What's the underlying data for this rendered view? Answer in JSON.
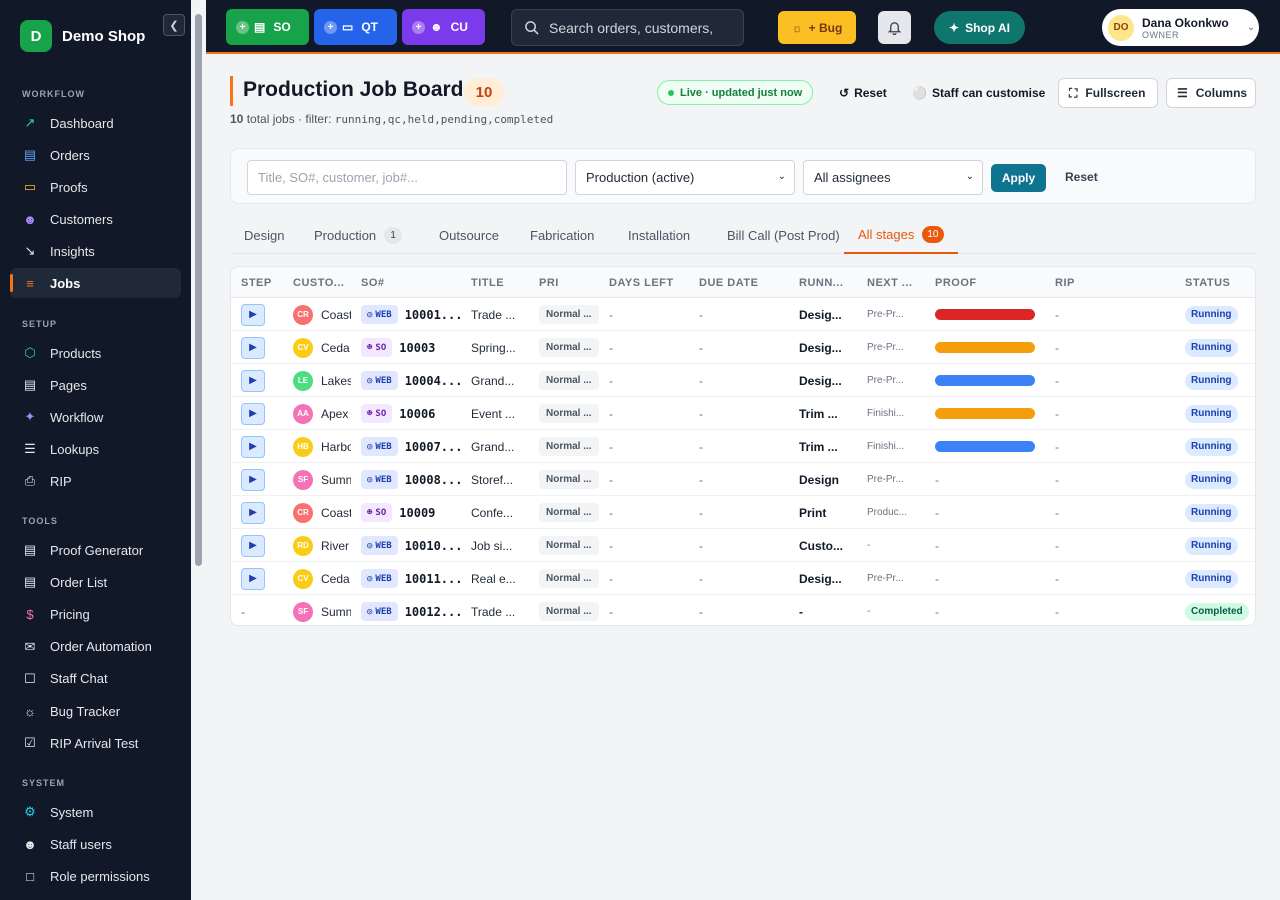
{
  "sidebar": {
    "brand": "Demo Shop",
    "logo_letter": "D",
    "collapse_icon": "chevron-left-icon",
    "sections": [
      {
        "label": "WORKFLOW",
        "items": [
          {
            "label": "Dashboard",
            "icon": "trend-icon",
            "color": "#34d399"
          },
          {
            "label": "Orders",
            "icon": "clipboard-icon",
            "color": "#60a5fa"
          },
          {
            "label": "Proofs",
            "icon": "file-icon",
            "color": "#fbbf24"
          },
          {
            "label": "Customers",
            "icon": "user-icon",
            "color": "#a78bfa"
          },
          {
            "label": "Insights",
            "icon": "chart-icon",
            "color": "#e5e7eb"
          },
          {
            "label": "Jobs",
            "icon": "list-icon",
            "color": "#f97316",
            "active": true
          }
        ]
      },
      {
        "label": "SETUP",
        "items": [
          {
            "label": "Products",
            "icon": "box-icon",
            "color": "#34d399"
          },
          {
            "label": "Pages",
            "icon": "page-icon",
            "color": "#e5e7eb"
          },
          {
            "label": "Workflow",
            "icon": "workflow-icon",
            "color": "#a78bfa"
          },
          {
            "label": "Lookups",
            "icon": "lookup-icon",
            "color": "#e5e7eb"
          },
          {
            "label": "RIP",
            "icon": "printer-icon",
            "color": "#e5e7eb"
          }
        ]
      },
      {
        "label": "TOOLS",
        "items": [
          {
            "label": "Proof Generator",
            "icon": "doc-icon",
            "color": "#e5e7eb"
          },
          {
            "label": "Order List",
            "icon": "clipboard-icon",
            "color": "#e5e7eb"
          },
          {
            "label": "Pricing",
            "icon": "dollar-icon",
            "color": "#f472b6"
          },
          {
            "label": "Order Automation",
            "icon": "mail-icon",
            "color": "#e5e7eb"
          },
          {
            "label": "Staff Chat",
            "icon": "chat-icon",
            "color": "#e5e7eb"
          },
          {
            "label": "Bug Tracker",
            "icon": "bug-icon",
            "color": "#e5e7eb"
          },
          {
            "label": "RIP Arrival Test",
            "icon": "check-icon",
            "color": "#e5e7eb"
          }
        ]
      },
      {
        "label": "SYSTEM",
        "items": [
          {
            "label": "System",
            "icon": "gear-icon",
            "color": "#22d3ee"
          },
          {
            "label": "Staff users",
            "icon": "users-icon",
            "color": "#e5e7eb"
          },
          {
            "label": "Role permissions",
            "icon": "lock-icon",
            "color": "#e5e7eb"
          }
        ]
      }
    ]
  },
  "topbar": {
    "quick": [
      {
        "label": "SO",
        "color": "#16a34a",
        "icon": "doc-icon"
      },
      {
        "label": "QT",
        "color": "#2563eb",
        "icon": "file-icon"
      },
      {
        "label": "CU",
        "color": "#7c3aed",
        "icon": "user-icon"
      }
    ],
    "search_placeholder": "Search orders, customers,",
    "bug_label": "+ Bug",
    "ai_label": "Shop AI",
    "user_initials": "DO",
    "user_name": "Dana Okonkwo",
    "user_role": "OWNER"
  },
  "header": {
    "title": "Production Job Board",
    "count": "10",
    "total_count": "10",
    "total_text": "total jobs · filter:",
    "filter_value": "running,qc,held,pending,completed",
    "live_label": "Live · updated just now",
    "reset_label": "Reset",
    "staff_label": "Staff can customise",
    "fullscreen_label": "Fullscreen",
    "columns_label": "Columns"
  },
  "filters": {
    "search_placeholder": "Title, SO#, customer, job#...",
    "stage_value": "Production (active)",
    "assignee_value": "All assignees",
    "apply_label": "Apply",
    "reset_label": "Reset"
  },
  "tabs": [
    {
      "label": "Design",
      "count": ""
    },
    {
      "label": "Production",
      "count": "1"
    },
    {
      "label": "Outsource",
      "count": ""
    },
    {
      "label": "Fabrication",
      "count": ""
    },
    {
      "label": "Installation",
      "count": ""
    },
    {
      "label": "Bill Call (Post Prod)",
      "count": ""
    },
    {
      "label": "All stages",
      "count": "10",
      "active": true
    }
  ],
  "table": {
    "columns": [
      "STEP",
      "CUSTO...",
      "SO#",
      "TITLE",
      "PRI",
      "DAYS LEFT",
      "DUE DATE",
      "RUNN...",
      "NEXT ...",
      "PROOF",
      "RIP",
      "STATUS"
    ],
    "rows": [
      {
        "step": "play",
        "initials": "CR",
        "avatar_color": "#f87171",
        "customer": "Coast",
        "source": "WEB",
        "so": "10001...",
        "title": "Trade ...",
        "pri": "Normal ...",
        "days": "-",
        "due": "-",
        "running": "Desig...",
        "next": "Pre-Pr...",
        "proof_color": "#dc2626",
        "rip": "-",
        "status": "Running"
      },
      {
        "step": "play",
        "initials": "CV",
        "avatar_color": "#facc15",
        "customer": "Ceda",
        "source": "SO",
        "so": "10003",
        "title": "Spring...",
        "pri": "Normal ...",
        "days": "-",
        "due": "-",
        "running": "Desig...",
        "next": "Pre-Pr...",
        "proof_color": "#f59e0b",
        "rip": "-",
        "status": "Running"
      },
      {
        "step": "play",
        "initials": "LE",
        "avatar_color": "#4ade80",
        "customer": "Lakes",
        "source": "WEB",
        "so": "10004...",
        "title": "Grand...",
        "pri": "Normal ...",
        "days": "-",
        "due": "-",
        "running": "Desig...",
        "next": "Pre-Pr...",
        "proof_color": "#3b82f6",
        "rip": "-",
        "status": "Running"
      },
      {
        "step": "play",
        "initials": "AA",
        "avatar_color": "#f472b6",
        "customer": "Apex",
        "source": "SO",
        "so": "10006",
        "title": "Event ...",
        "pri": "Normal ...",
        "days": "-",
        "due": "-",
        "running": "Trim ...",
        "next": "Finishi...",
        "proof_color": "#f59e0b",
        "rip": "-",
        "status": "Running"
      },
      {
        "step": "play",
        "initials": "HB",
        "avatar_color": "#facc15",
        "customer": "Harbo",
        "source": "WEB",
        "so": "10007...",
        "title": "Grand...",
        "pri": "Normal ...",
        "days": "-",
        "due": "-",
        "running": "Trim ...",
        "next": "Finishi...",
        "proof_color": "#3b82f6",
        "rip": "-",
        "status": "Running"
      },
      {
        "step": "play",
        "initials": "SF",
        "avatar_color": "#f472b6",
        "customer": "Sumn",
        "source": "WEB",
        "so": "10008...",
        "title": "Storef...",
        "pri": "Normal ...",
        "days": "-",
        "due": "-",
        "running": "Design",
        "next": "Pre-Pr...",
        "proof_color": "",
        "rip": "-",
        "status": "Running"
      },
      {
        "step": "play",
        "initials": "CR",
        "avatar_color": "#f87171",
        "customer": "Coast",
        "source": "SO",
        "so": "10009",
        "title": "Confe...",
        "pri": "Normal ...",
        "days": "-",
        "due": "-",
        "running": "Print",
        "next": "Produc...",
        "proof_color": "",
        "rip": "-",
        "status": "Running"
      },
      {
        "step": "play",
        "initials": "RD",
        "avatar_color": "#facc15",
        "customer": "River",
        "source": "WEB",
        "so": "10010...",
        "title": "Job si...",
        "pri": "Normal ...",
        "days": "-",
        "due": "-",
        "running": "Custo...",
        "next": "-",
        "proof_color": "",
        "rip": "-",
        "status": "Running"
      },
      {
        "step": "play",
        "initials": "CV",
        "avatar_color": "#facc15",
        "customer": "Ceda",
        "source": "WEB",
        "so": "10011...",
        "title": "Real e...",
        "pri": "Normal ...",
        "days": "-",
        "due": "-",
        "running": "Desig...",
        "next": "Pre-Pr...",
        "proof_color": "",
        "rip": "-",
        "status": "Running"
      },
      {
        "step": "-",
        "initials": "SF",
        "avatar_color": "#f472b6",
        "customer": "Sumn",
        "source": "WEB",
        "so": "10012...",
        "title": "Trade ...",
        "pri": "Normal ...",
        "days": "-",
        "due": "-",
        "running": "-",
        "next": "-",
        "proof_color": "",
        "rip": "-",
        "status": "Completed"
      }
    ]
  }
}
